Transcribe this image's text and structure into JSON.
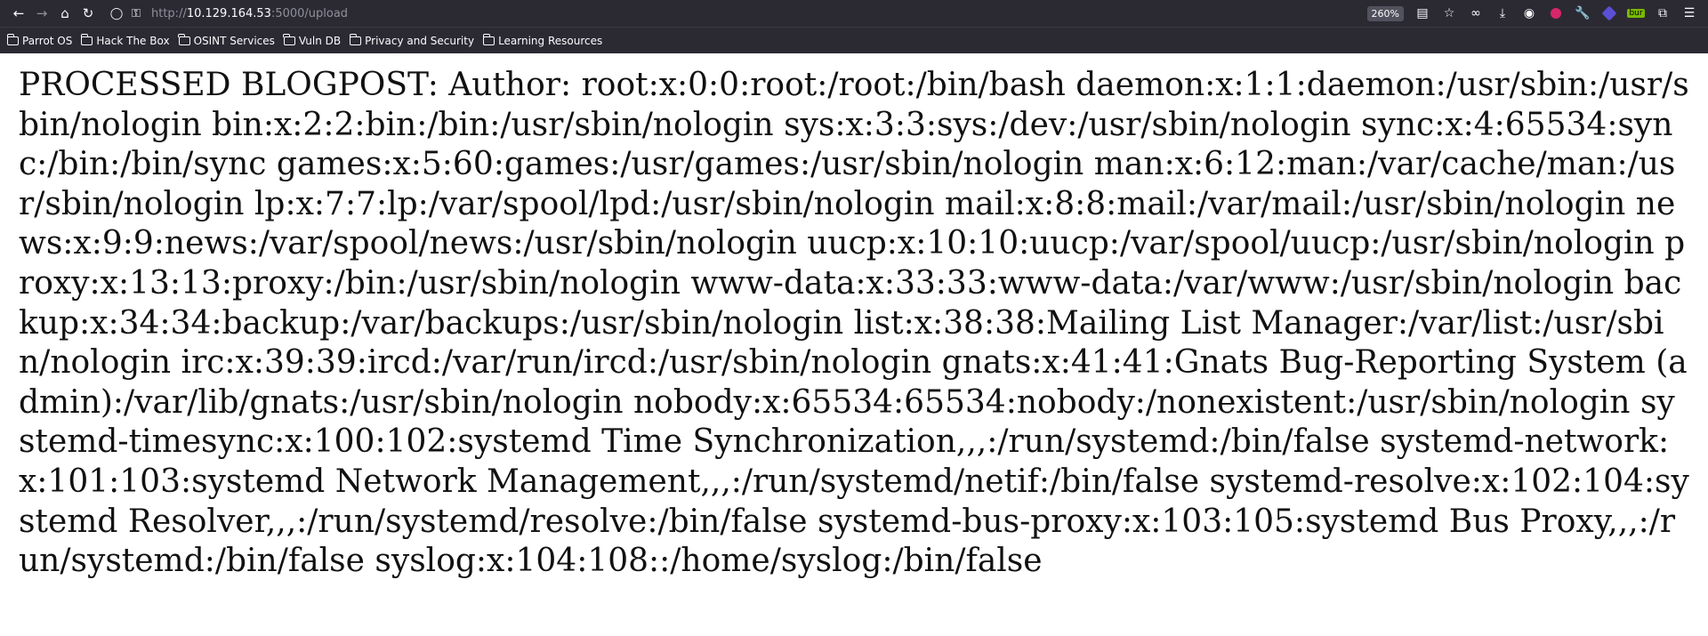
{
  "browser": {
    "url_prefix": "http://",
    "url_host": "10.129.164.53",
    "url_rest": ":5000/upload",
    "zoom": "260%",
    "nav_icons": [
      "back-icon",
      "forward-icon",
      "home-icon",
      "reload-icon"
    ],
    "right_icons": [
      "reader-view-icon",
      "bookmark-star-icon",
      "infinity-icon",
      "download-icon",
      "account-icon",
      "extension-icon",
      "wrench-icon",
      "diamond-icon",
      "burp-icon",
      "extensions-puzzle-icon",
      "menu-icon"
    ],
    "burp_label": "bur"
  },
  "bookmarks": [
    {
      "label": "Parrot OS"
    },
    {
      "label": "Hack The Box"
    },
    {
      "label": "OSINT Services"
    },
    {
      "label": "Vuln DB"
    },
    {
      "label": "Privacy and Security"
    },
    {
      "label": "Learning Resources"
    }
  ],
  "page": {
    "body_text": "PROCESSED BLOGPOST: Author: root:x:0:0:root:/root:/bin/bash daemon:x:1:1:daemon:/usr/sbin:/usr/sbin/nologin bin:x:2:2:bin:/bin:/usr/sbin/nologin sys:x:3:3:sys:/dev:/usr/sbin/nologin sync:x:4:65534:sync:/bin:/bin/sync games:x:5:60:games:/usr/games:/usr/sbin/nologin man:x:6:12:man:/var/cache/man:/usr/sbin/nologin lp:x:7:7:lp:/var/spool/lpd:/usr/sbin/nologin mail:x:8:8:mail:/var/mail:/usr/sbin/nologin news:x:9:9:news:/var/spool/news:/usr/sbin/nologin uucp:x:10:10:uucp:/var/spool/uucp:/usr/sbin/nologin proxy:x:13:13:proxy:/bin:/usr/sbin/nologin www-data:x:33:33:www-data:/var/www:/usr/sbin/nologin backup:x:34:34:backup:/var/backups:/usr/sbin/nologin list:x:38:38:Mailing List Manager:/var/list:/usr/sbin/nologin irc:x:39:39:ircd:/var/run/ircd:/usr/sbin/nologin gnats:x:41:41:Gnats Bug-Reporting System (admin):/var/lib/gnats:/usr/sbin/nologin nobody:x:65534:65534:nobody:/nonexistent:/usr/sbin/nologin systemd-timesync:x:100:102:systemd Time Synchronization,,,:/run/systemd:/bin/false systemd-network:x:101:103:systemd Network Management,,,:/run/systemd/netif:/bin/false systemd-resolve:x:102:104:systemd Resolver,,,:/run/systemd/resolve:/bin/false systemd-bus-proxy:x:103:105:systemd Bus Proxy,,,:/run/systemd:/bin/false syslog:x:104:108::/home/syslog:/bin/false"
  },
  "colors": {
    "chrome_bg": "#2b2a33",
    "chrome_text": "#fbfbfe",
    "page_bg": "#ffffff",
    "page_text": "#111111"
  }
}
